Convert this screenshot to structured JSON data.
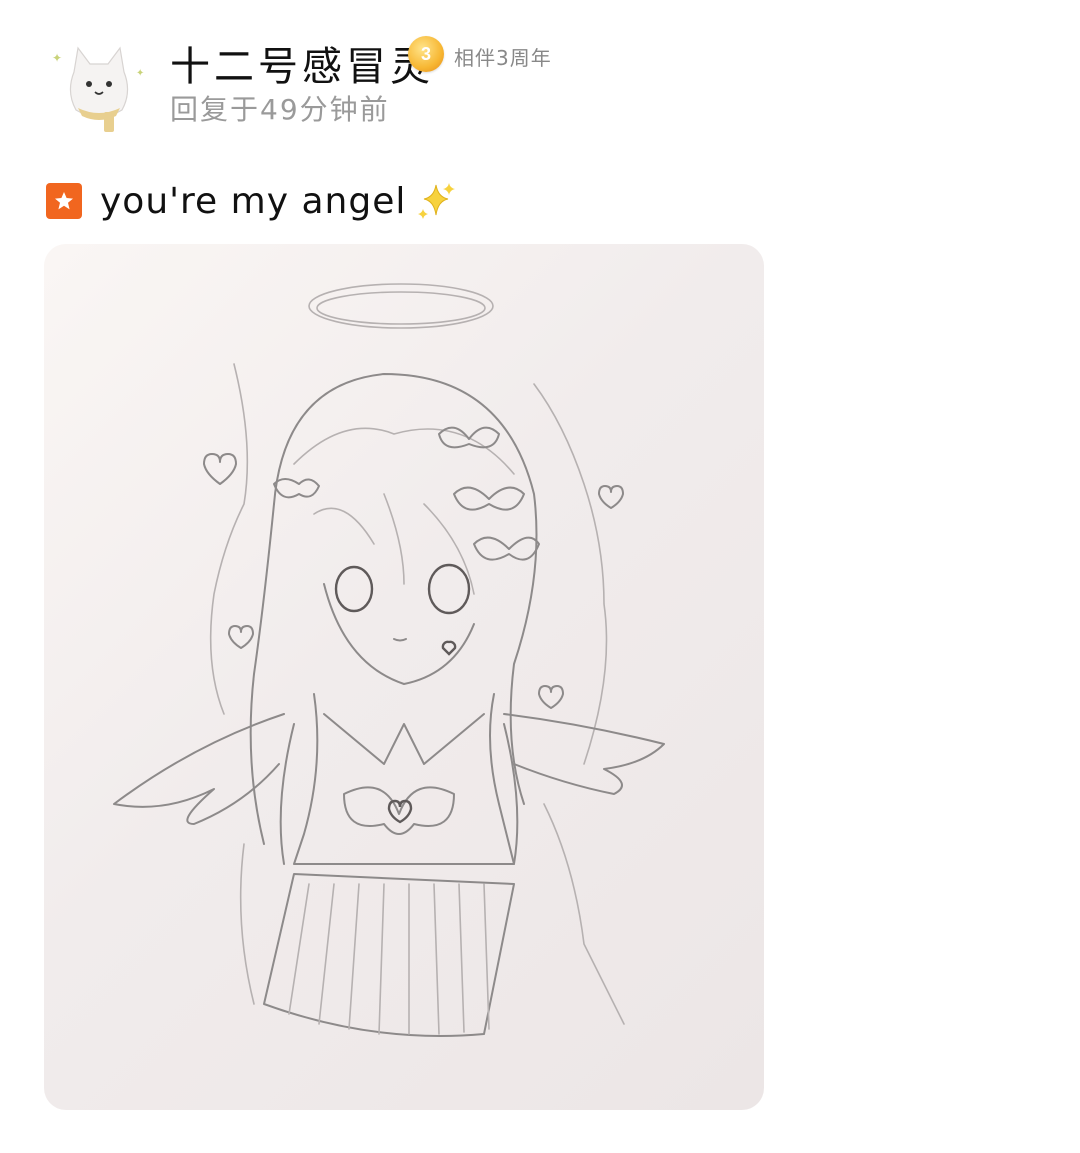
{
  "post": {
    "user_name": "十二号感冒灵",
    "level_badge": "3",
    "companion_tag": "相伴3周年",
    "reply_time": "回复于49分钟前",
    "content_text": "you're my angel",
    "content_emoji": "sparkles-icon"
  },
  "colors": {
    "bookmark": "#f1661f",
    "badge": "#f7b733",
    "name": "#111111",
    "meta": "#9a9a9a"
  },
  "image": {
    "subject": "pencil sketch of an angel girl with halo, wings and bows"
  }
}
